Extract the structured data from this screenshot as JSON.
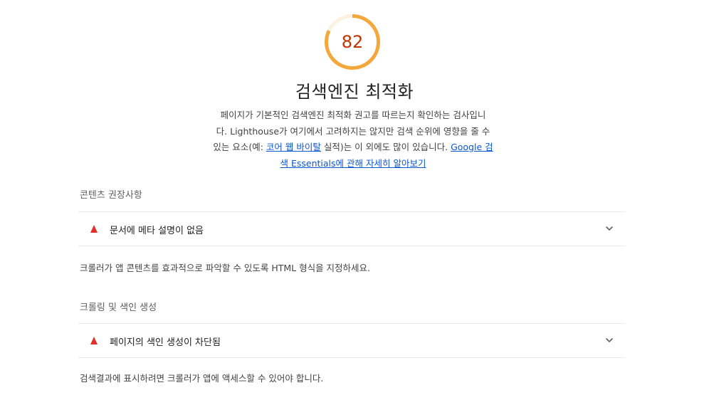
{
  "score": {
    "value": "82",
    "fraction": 0.82,
    "color": "#f4a83b",
    "text_color": "#c33300"
  },
  "category": {
    "title": "검색엔진 최적화",
    "desc_line1": "페이지가 기본적인 검색엔진 최적화 권고를 따르는지 확인하는 검사입니",
    "desc_line2": "다. Lighthouse가 여기에서 고려하지는 않지만 검색 순위에 영향을 줄 수",
    "desc_line3_a": "있는 요소(예: ",
    "desc_link1": "코어 웹 바이탈",
    "desc_line3_b": " 실적)는 이 외에도 많이 있습니다. ",
    "desc_link2_part1": "Google 검",
    "desc_link2_part2": "색 Essentials에 관해 자세히 알아보기"
  },
  "groups": [
    {
      "title": "콘텐츠 권장사항",
      "audit_title": "문서에 메타 설명이 없음",
      "description": "크롤러가 앱 콘텐츠를 효과적으로 파악할 수 있도록 HTML 형식을 지정하세요."
    },
    {
      "title": "크롤링 및 색인 생성",
      "audit_title": "페이지의 색인 생성이 차단됨",
      "description": "검색결과에 표시하려면 크롤러가 앱에 액세스할 수 있어야 합니다."
    }
  ],
  "icons": {
    "fail": "warning-triangle-icon",
    "expand": "chevron-down-icon"
  }
}
